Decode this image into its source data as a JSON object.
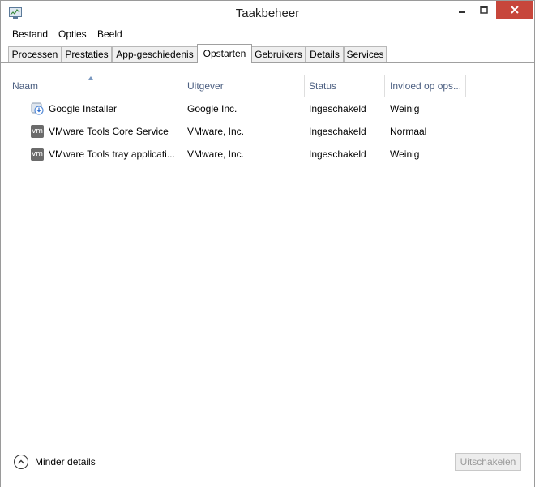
{
  "window": {
    "title": "Taakbeheer"
  },
  "menu": [
    "Bestand",
    "Opties",
    "Beeld"
  ],
  "tabs": [
    "Processen",
    "Prestaties",
    "App-geschiedenis",
    "Opstarten",
    "Gebruikers",
    "Details",
    "Services"
  ],
  "active_tab": "Opstarten",
  "table": {
    "columns": [
      "Naam",
      "Uitgever",
      "Status",
      "Invloed op ops..."
    ],
    "sort_column": "Naam",
    "rows": [
      {
        "icon": "google-installer-icon",
        "name": "Google Installer",
        "publisher": "Google Inc.",
        "status": "Ingeschakeld",
        "impact": "Weinig"
      },
      {
        "icon": "vmware-icon",
        "name": "VMware Tools Core Service",
        "publisher": "VMware, Inc.",
        "status": "Ingeschakeld",
        "impact": "Normaal"
      },
      {
        "icon": "vmware-icon",
        "name": "VMware Tools tray applicati...",
        "publisher": "VMware, Inc.",
        "status": "Ingeschakeld",
        "impact": "Weinig"
      }
    ]
  },
  "footer": {
    "less_details_label": "Minder details",
    "disable_button_label": "Uitschakelen"
  },
  "colors": {
    "close_button": "#c7463b",
    "column_header_text": "#4d6082"
  }
}
